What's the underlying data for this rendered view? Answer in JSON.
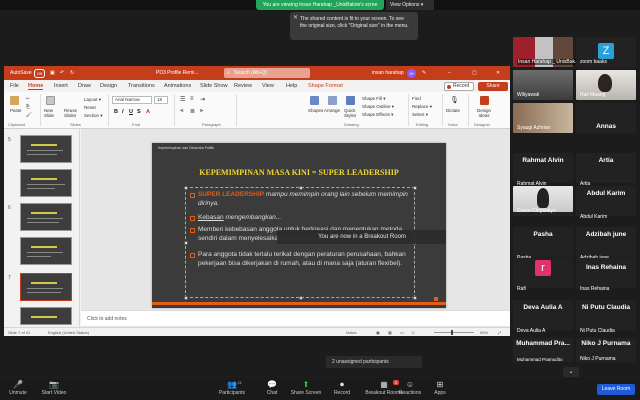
{
  "banner": {
    "viewing_text": "You are viewing Insan Harahap _UnisBakrie's scree",
    "view_options": "View Options ▾"
  },
  "tooltip": {
    "text": "The shared content is fit to your screen. To see the original size, click \"Original size\" in the menu."
  },
  "ppt": {
    "autosave": "AutoSave",
    "toggle": "Off",
    "filename": "PD3 Profile Remi...",
    "search_placeholder": "Search (Alt+Q)",
    "user": "insan harahap",
    "user_initials": "IH",
    "menu": [
      "File",
      "Home",
      "Insert",
      "Draw",
      "Design",
      "Transitions",
      "Animations",
      "Slide Show",
      "Review",
      "View",
      "Help",
      "Shape Format"
    ],
    "record": "Record",
    "share": "Share",
    "ribbon": {
      "paste": "Paste",
      "new_slide": "New Slide",
      "reuse_slides": "Reuse Slides",
      "layout": "Layout ▾",
      "reset": "Reset",
      "section": "Section ▾",
      "font_name": "Arial Narrow",
      "font_size": "18",
      "shapes": "Shapes",
      "arrange": "Arrange",
      "quick_styles": "Quick Styles",
      "shape_fill": "Shape Fill ▾",
      "shape_outline": "Shape Outline ▾",
      "shape_effects": "Shape Effects ▾",
      "find": "Find",
      "replace": "Replace ▾",
      "select": "Select ▾",
      "dictate": "Dictate",
      "design_ideas": "Design Ideas",
      "groups": [
        "Clipboard",
        "Slides",
        "Font",
        "Paragraph",
        "Drawing",
        "Editing",
        "Voice",
        "Designer"
      ]
    },
    "thumbnails": [
      "5",
      "6",
      "7"
    ],
    "slide": {
      "header": "Kepemimpinan dan Dinamika Politik",
      "title": "KEPEMIMPINAN MASA KINI = SUPER LEADERSHIP",
      "bullets": [
        {
          "pre": "SUPER LEADERSHIP",
          "text": " mampu memimpin orang lain sebelum memimpin dirinya."
        },
        {
          "pre": "Kebasan",
          "text": " mengembangkan..."
        },
        {
          "pre": "",
          "text": "Memberi kebebasan anggota untuk berkreasi dan menentukan metoda sendiri dalam menyelesaikan pekerjaannya."
        },
        {
          "pre": "",
          "text": "Para anggota tidak terlalu terikat dengan peraturan perusahaan, bahkan pekerjaan bisa dikerjakan di rumah, atau di mana saja (aturan flexibel)."
        }
      ]
    },
    "breakout_toast": "You are now in a Breakout Room",
    "notes": "Click to add notes",
    "status": {
      "slide": "Slide 7 of 41",
      "lang": "English (United States)",
      "notes": "Notes",
      "zoom": "55%"
    }
  },
  "participants": [
    {
      "name": "Insan Harahap _ UnisBak...",
      "kind": "video"
    },
    {
      "name": "zoom baaks",
      "letter": "Z",
      "color": "#2aa0d8"
    },
    {
      "name": "Wiliyawati",
      "kind": "video"
    },
    {
      "name": "Hali Maang",
      "kind": "video"
    },
    {
      "name": "Syaugi Azhrian",
      "kind": "video"
    },
    {
      "name": "Annas",
      "kind": "name"
    },
    {
      "name": "Rahmat Alvin",
      "kind": "name"
    },
    {
      "name": "Artia",
      "kind": "name"
    },
    {
      "name": "Grace Chrystalyn",
      "kind": "video"
    },
    {
      "name": "Abdul Karim",
      "kind": "name"
    },
    {
      "name": "Pasha",
      "kind": "name"
    },
    {
      "name": "Adzibah june",
      "kind": "name"
    },
    {
      "name": "Rafi",
      "letter": "r",
      "color": "#e0336b"
    },
    {
      "name": "Inas Rehaina",
      "kind": "name"
    },
    {
      "name": "Deva Aulia A",
      "kind": "name"
    },
    {
      "name": "Ni Putu Claudia",
      "kind": "name"
    },
    {
      "name": "Muhammad Pramudito",
      "big": "Muhammad Pra...",
      "kind": "name"
    },
    {
      "name": "Niko J Purnama",
      "kind": "name"
    }
  ],
  "unassigned": "2 unassigned participants",
  "toolbar": {
    "unmute": "Unmute",
    "start_video": "Start Video",
    "participants": "Participants",
    "participants_count": "21",
    "chat": "Chat",
    "share_screen": "Share Screen",
    "record": "Record",
    "breakout_rooms": "Breakout Rooms",
    "breakout_badge": "2",
    "reactions": "Reactions",
    "apps": "Apps",
    "leave": "Leave Room"
  }
}
